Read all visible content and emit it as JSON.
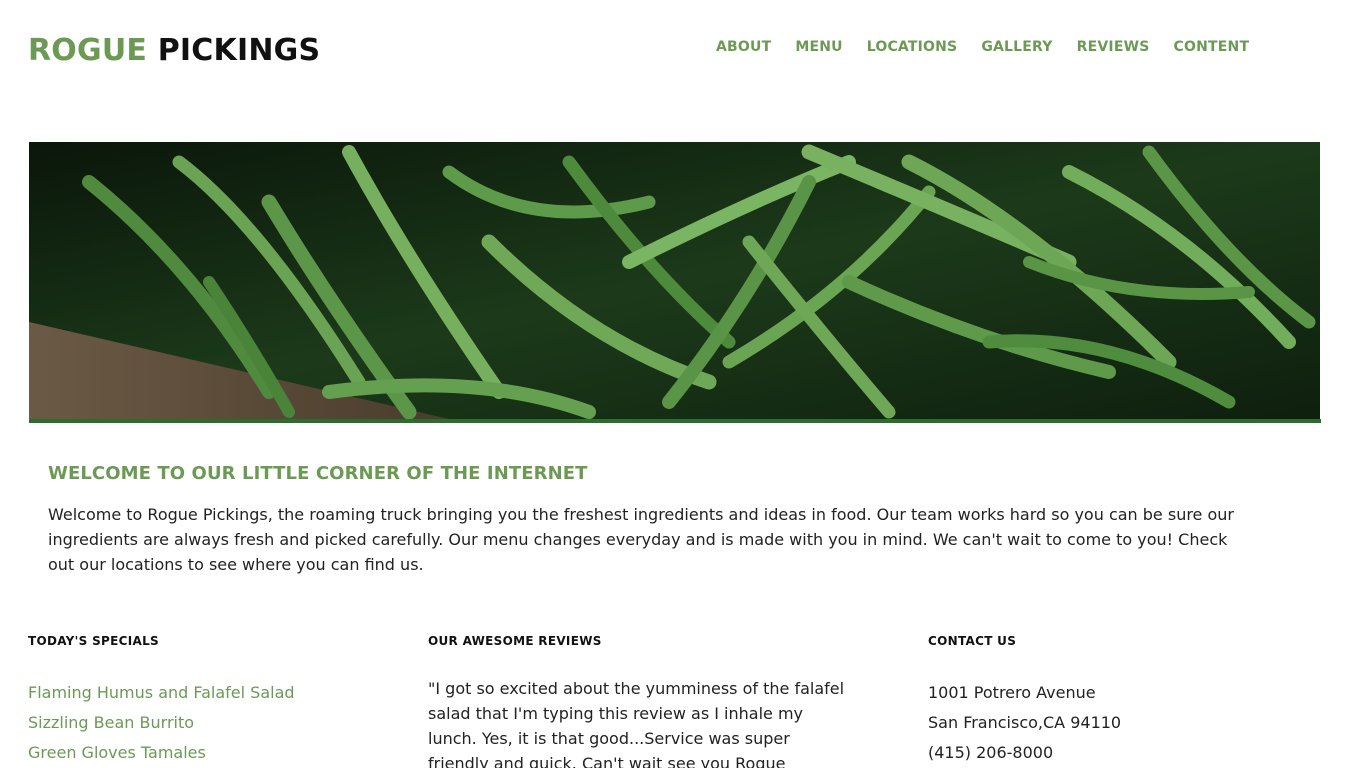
{
  "header": {
    "logo_part1": "ROGUE",
    "logo_part2": "PICKINGS",
    "nav": [
      "ABOUT",
      "MENU",
      "LOCATIONS",
      "GALLERY",
      "REVIEWS",
      "CONTENT"
    ]
  },
  "hero": {
    "image": "green-beans-photo"
  },
  "welcome": {
    "title": "WELCOME TO OUR LITTLE CORNER OF THE INTERNET",
    "text": "Welcome to Rogue Pickings, the roaming truck bringing you the freshest ingredients and ideas in food. Our team works hard so you can be sure our ingredients are always fresh and picked carefully. Our menu changes everyday and is made with you in mind. We can't wait to come to you! Check out our locations to see where you can find us."
  },
  "specials": {
    "heading": "TODAY'S SPECIALS",
    "items": [
      "Flaming Humus and Falafel Salad",
      "Sizzling Bean Burrito",
      "Green Gloves Tamales"
    ]
  },
  "reviews": {
    "heading": "OUR AWESOME REVIEWS",
    "text": "\"I got so excited about the yumminess of the falafel salad that I'm typing this review as I inhale my lunch. Yes, it is that good...Service was super friendly and quick. Can't wait see you Rogue"
  },
  "contact": {
    "heading": "CONTACT US",
    "lines": [
      "1001 Potrero Avenue",
      "San Francisco,CA 94110",
      "(415) 206-8000"
    ]
  },
  "colors": {
    "accent": "#6c9a55",
    "hero_border": "#2e6b2e"
  }
}
